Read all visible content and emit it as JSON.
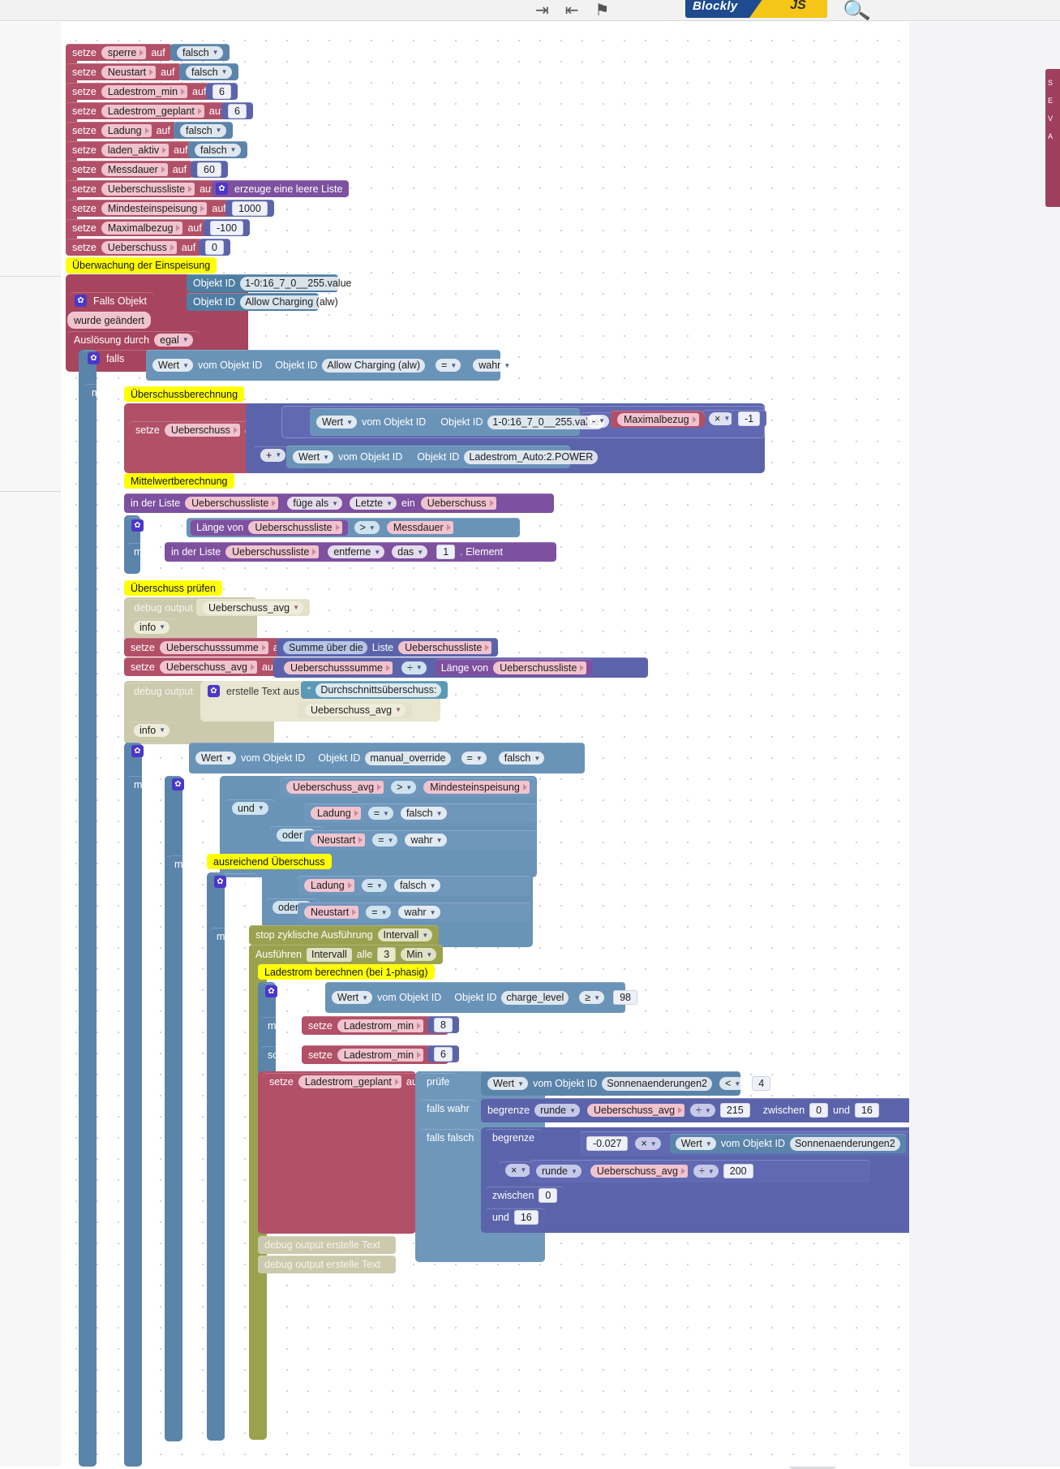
{
  "app": {
    "name": "Blockly",
    "name_suffix": "JS",
    "toolbar_icons": [
      "export-icon",
      "import-icon",
      "flag-icon",
      "search-icon"
    ]
  },
  "flyout": {
    "letters": [
      "S",
      "E",
      "V",
      "A"
    ]
  },
  "comments": {
    "ueberwachung": "Überwachung der Einspeisung",
    "ueberschussberechnung": "Überschussberechnung",
    "mittelwertberechnung": "Mittelwertberechnung",
    "ueberschuss_pruefen": "Überschuss prüfen",
    "ausreichend": "ausreichend Überschuss",
    "ladestrom_berechnen": "Ladestrom berechnen (bei 1-phasig)"
  },
  "words": {
    "setze": "setze",
    "auf": "auf",
    "falls": "falls",
    "mache": "mache",
    "sonst": "sonst",
    "und": "und",
    "oder": "oder",
    "wert": "Wert",
    "vom_objekt_id": "vom Objekt ID",
    "objekt_id": "Objekt ID",
    "falls_objekt": "Falls Objekt",
    "wurde_geaendert": "wurde geändert",
    "ausloesung_durch": "Auslösung durch",
    "egal": "egal",
    "erzeuge_leere_liste": "erzeuge eine leere Liste",
    "in_der_liste": "in der Liste",
    "fuege_als": "füge als",
    "letzte": "Letzte",
    "ein": "ein",
    "laenge_von": "Länge von",
    "entferne": "entferne",
    "das": "das",
    "element": ". Element",
    "debug_output": "debug output",
    "info": "info",
    "summe_ueber_die": "Summe über die",
    "liste": "Liste",
    "erstelle_text_aus": "erstelle Text aus",
    "debug_output_erstelle_text": "debug output erstelle Text",
    "stop_zyklisch": "stop zyklische Ausführung",
    "intervall": "Intervall",
    "ausfuehren": "Ausführen",
    "alle": "alle",
    "min": "Min",
    "pruefe": "prüfe",
    "falls_wahr": "falls wahr",
    "falls_falsch": "falls falsch",
    "begrenze": "begrenze",
    "runde": "runde",
    "zwischen": "zwischen",
    "und_w": "und",
    "wahr": "wahr",
    "falsch": "falsch"
  },
  "vars": {
    "sperre": "sperre",
    "neustart": "Neustart",
    "ladestrom_min": "Ladestrom_min",
    "ladestrom_geplant": "Ladestrom_geplant",
    "ladung": "Ladung",
    "laden_aktiv": "laden_aktiv",
    "messdauer": "Messdauer",
    "ueberschussliste": "Ueberschussliste",
    "mindesteinspeisung": "Mindesteinspeisung",
    "maximalbezug": "Maximalbezug",
    "ueberschuss": "Ueberschuss",
    "ueberschusssumme": "Ueberschusssumme",
    "ueberschuss_avg": "Ueberschuss_avg"
  },
  "objects": {
    "power_meter": "1-0:16_7_0__255.value",
    "allow_charging": "Allow Charging (alw)",
    "ladestrom_auto": "Ladestrom_Auto:2.POWER",
    "manual_override": "manual_override",
    "charge_level": "charge_level",
    "sonnenaenderungen2": "Sonnenaenderungen2"
  },
  "setters": [
    {
      "var": "sperre",
      "type": "bool",
      "value": "falsch"
    },
    {
      "var": "Neustart",
      "type": "bool",
      "value": "falsch"
    },
    {
      "var": "Ladestrom_min",
      "type": "num",
      "value": "6"
    },
    {
      "var": "Ladestrom_geplant",
      "type": "num",
      "value": "6"
    },
    {
      "var": "Ladung",
      "type": "bool",
      "value": "falsch"
    },
    {
      "var": "laden_aktiv",
      "type": "bool",
      "value": "falsch"
    },
    {
      "var": "Messdauer",
      "type": "num",
      "value": "60"
    },
    {
      "var": "Ueberschussliste",
      "type": "list",
      "value": "erzeuge eine leere Liste"
    },
    {
      "var": "Mindesteinspeisung",
      "type": "num",
      "value": "1000"
    },
    {
      "var": "Maximalbezug",
      "type": "num",
      "value": "-100"
    },
    {
      "var": "Ueberschuss",
      "type": "num",
      "value": "0"
    }
  ],
  "ops": {
    "eq": "=",
    "gt": ">",
    "lt": "<",
    "gte": "≥",
    "minus": "-",
    "plus": "+",
    "times": "×",
    "divide": "÷"
  },
  "values": {
    "minus_one": "-1",
    "one": "1",
    "three": "3",
    "four": "4",
    "six": "6",
    "eight": "8",
    "zero": "0",
    "sixteen": "16",
    "n98": "98",
    "n215": "215",
    "n200": "200",
    "n_0_027": "-0.027"
  },
  "texts": {
    "durchschnitt": "Durchschnittsüberschuss:"
  }
}
